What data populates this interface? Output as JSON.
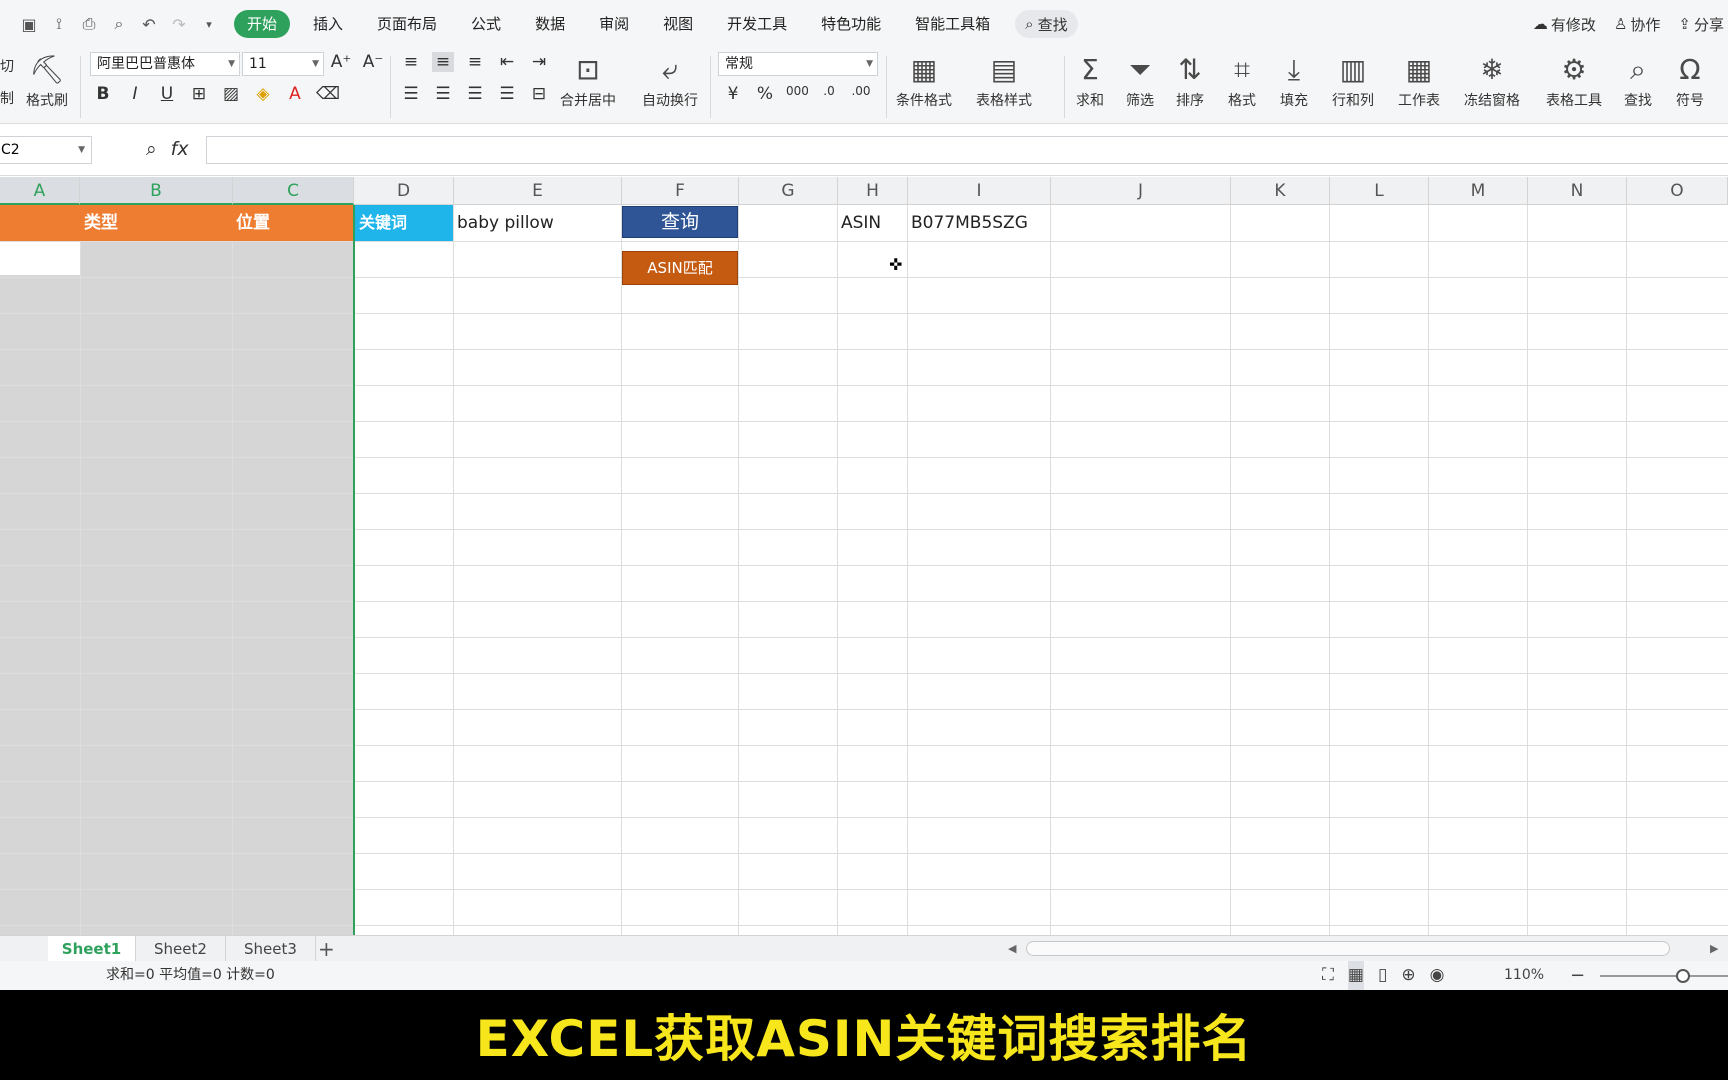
{
  "menubar": {
    "tabs": [
      "开始",
      "插入",
      "页面布局",
      "公式",
      "数据",
      "审阅",
      "视图",
      "开发工具",
      "特色功能",
      "智能工具箱"
    ],
    "search_label": "查找",
    "right": {
      "modified": "有修改",
      "collab": "协作",
      "share": "分享"
    }
  },
  "ribbon": {
    "cut": "剪切",
    "copy": "复制",
    "format_painter": "格式刷",
    "font_name": "阿里巴巴普惠体",
    "font_size": "11",
    "merge_center": "合并居中",
    "wrap_text": "自动换行",
    "number_format": "常规",
    "conditional_format": "条件格式",
    "table_style": "表格样式",
    "sum": "求和",
    "filter": "筛选",
    "sort": "排序",
    "format": "格式",
    "fill": "填充",
    "row_col": "行和列",
    "worksheet": "工作表",
    "freeze": "冻结窗格",
    "table_tools": "表格工具",
    "find": "查找",
    "symbol": "符号"
  },
  "formula": {
    "namebox": "C2",
    "value": ""
  },
  "columns": [
    "A",
    "B",
    "C",
    "D",
    "E",
    "F",
    "G",
    "H",
    "I",
    "J",
    "K",
    "L",
    "M",
    "N",
    "O"
  ],
  "cells": {
    "B1": "类型",
    "C1": "位置",
    "D1": "关键词",
    "E1": "baby pillow",
    "H1": "ASIN",
    "I1": "B077MB5SZG"
  },
  "buttons": {
    "query": "查询",
    "asin_match": "ASIN匹配"
  },
  "sheets": [
    "Sheet1",
    "Sheet2",
    "Sheet3"
  ],
  "status": {
    "summary": "求和=0 平均值=0 计数=0",
    "zoom": "110%"
  },
  "caption": "EXCEL获取ASIN关键词搜索排名",
  "colors": {
    "accent_green": "#2ea25c",
    "header_orange": "#ee7d31",
    "keyword_blue": "#1fb4ea",
    "query_button": "#2f5596",
    "asin_button": "#c55a11",
    "caption_yellow": "#f7e61c"
  }
}
